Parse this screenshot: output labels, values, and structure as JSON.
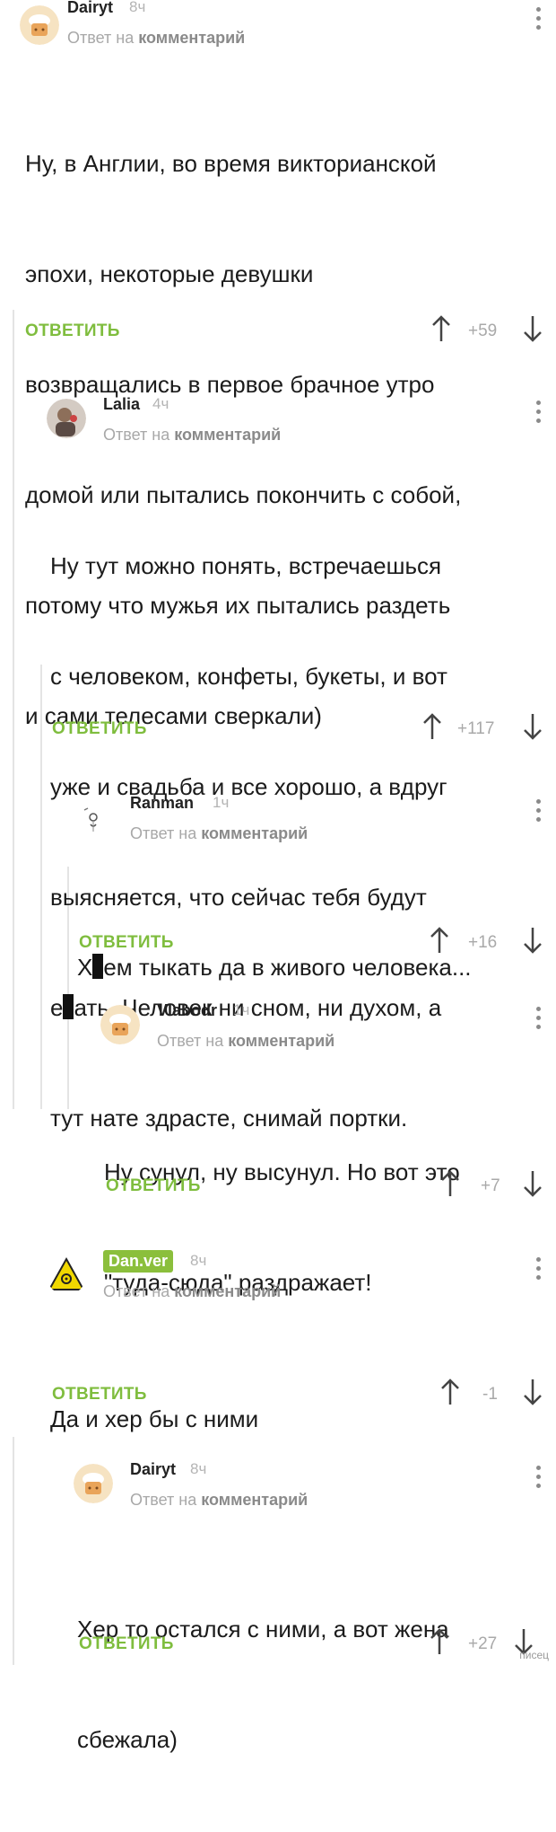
{
  "reply_prefix": "Ответ на",
  "reply_target": "комментарий",
  "reply_label": "ОТВЕТИТЬ",
  "comments": [
    {
      "author": "Dairyt",
      "time": "8ч",
      "avatar": "chef-icon",
      "body_lines": [
        "Ну, в Англии, во время викторианской",
        "эпохи, некоторые девушки",
        "возвращались в первое брачное утро",
        "домой или пытались покончить с собой,",
        "потому что мужья их пытались раздеть",
        "и сами телесами сверкали)"
      ],
      "rating": "+59"
    },
    {
      "author": "Lalia",
      "time": "4ч",
      "avatar": "photo-avatar",
      "body_lines": [
        "Ну тут можно понять, встречаешься",
        "с человеком, конфеты, букеты, и вот",
        "уже и свадьба и все хорошо, а вдруг",
        "выясняется, что сейчас тебя будут"
      ],
      "body_censored_pre": "е",
      "body_censored_post": "ать. Человек ни сном, ни духом, а",
      "body_last": "тут нате здрасте, снимай портки.",
      "rating": "+117"
    },
    {
      "author": "Ranman",
      "time": "1ч",
      "avatar": "sketch-avatar",
      "body_censored_pre": "Х",
      "body_censored_post": "ем тыкать да в живого человека...",
      "rating": "+16"
    },
    {
      "author": "Vlabodr",
      "time": "1ч",
      "avatar": "chef-icon",
      "body_lines": [
        "Ну сунул, ну высунул. Но вот это",
        "\"туда-сюда\" раздражает!"
      ],
      "rating": "+7"
    },
    {
      "author": "Dan.ver",
      "time": "8ч",
      "avatar": "hazard-icon",
      "body_lines": [
        "Да и хер бы с ними"
      ],
      "rating": "-1"
    },
    {
      "author": "Dairyt",
      "time": "8ч",
      "avatar": "chef-icon",
      "body_lines": [
        "Хер то остался с ними, а вот жена",
        "сбежала)"
      ],
      "rating": "+27"
    }
  ],
  "watermark": "писец",
  "colors": {
    "accent": "#7fbd3e",
    "muted": "#a8a8a8",
    "badge": "#8bbf3c"
  }
}
